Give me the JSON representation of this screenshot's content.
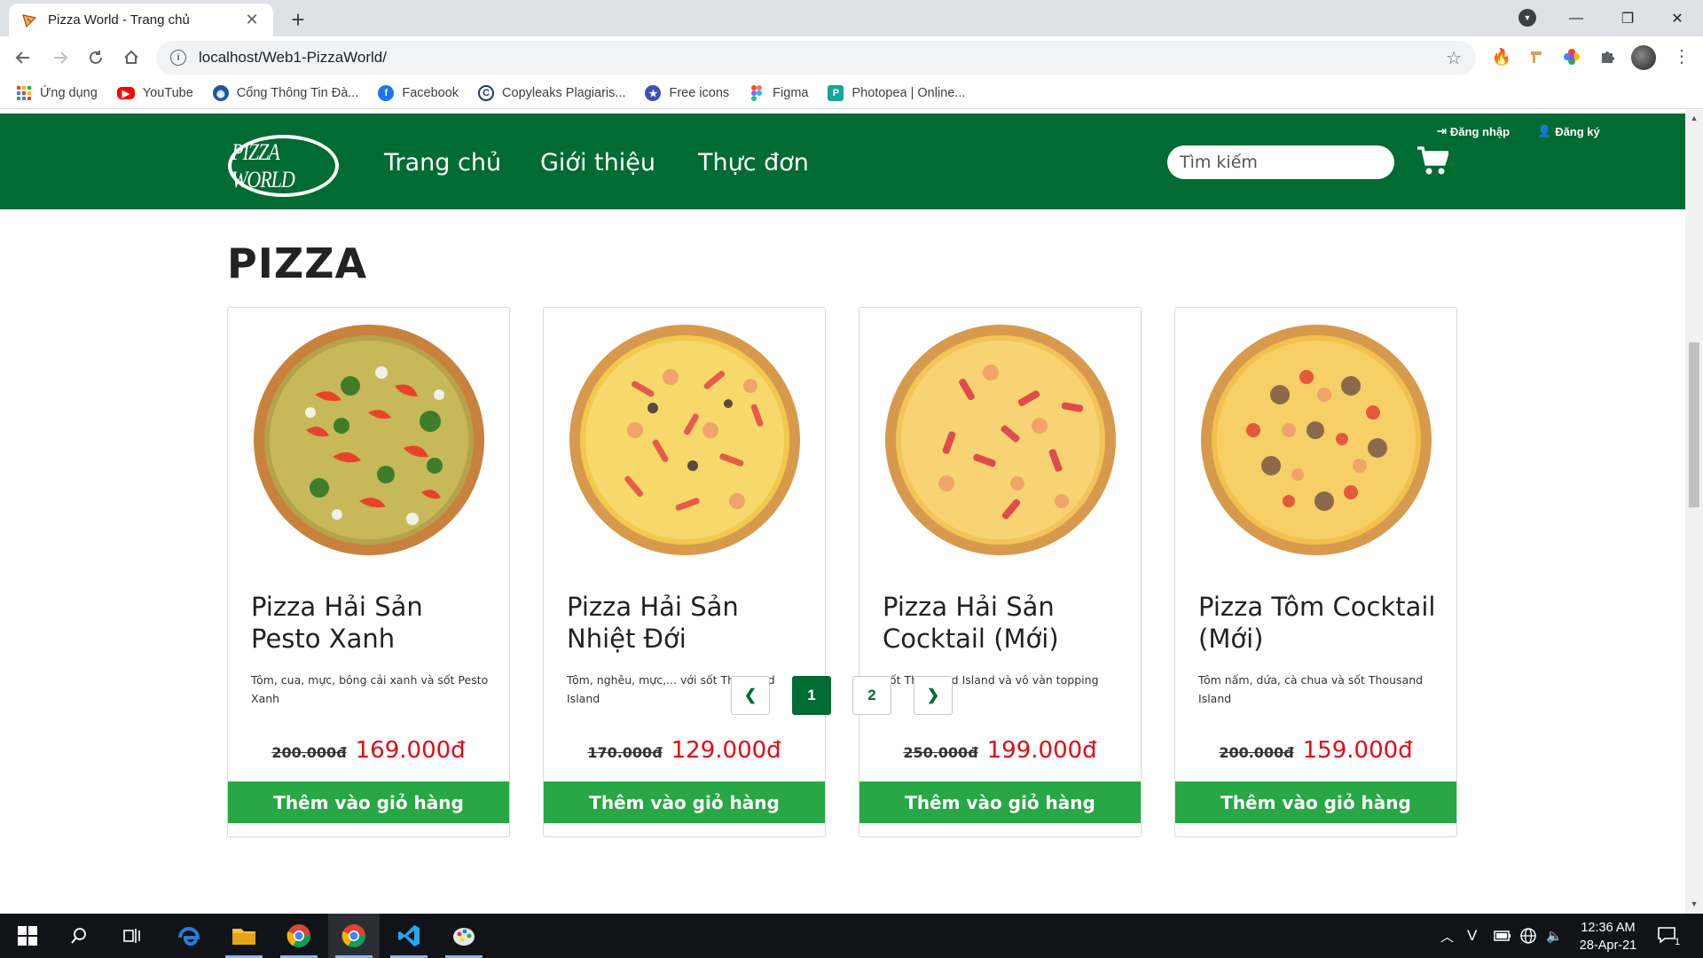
{
  "browser": {
    "tab_title": "Pizza World - Trang chủ",
    "url": "localhost/Web1-PizzaWorld/",
    "bookmarks": [
      {
        "label": "Ứng dụng",
        "icon": "apps-grid-icon",
        "color": "#ea4335"
      },
      {
        "label": "YouTube",
        "icon": "youtube-icon",
        "color": "#ff0000"
      },
      {
        "label": "Cổng Thông Tin Đà...",
        "icon": "portal-icon",
        "color": "#1a56a8"
      },
      {
        "label": "Facebook",
        "icon": "facebook-icon",
        "color": "#1877f2"
      },
      {
        "label": "Copyleaks Plagiaris...",
        "icon": "copyleaks-icon",
        "color": "#1e3a5f"
      },
      {
        "label": "Free icons",
        "icon": "free-icons-icon",
        "color": "#3f51b5"
      },
      {
        "label": "Figma",
        "icon": "figma-icon",
        "color": "#f24e1e"
      },
      {
        "label": "Photopea | Online...",
        "icon": "photopea-icon",
        "color": "#18a497"
      }
    ]
  },
  "header": {
    "logo_text": "PIZZA WORLD",
    "nav": [
      "Trang chủ",
      "Giới thiệu",
      "Thực đơn"
    ],
    "search_placeholder": "Tìm kiếm",
    "login": "Đăng nhập",
    "register": "Đăng ký",
    "brand_color": "#006b32"
  },
  "section_title": "PIZZA",
  "products": [
    {
      "name": "Pizza Hải Sản Pesto Xanh",
      "desc": "Tôm, cua, mực, bông cải xanh và sốt Pesto Xanh",
      "old_price": "200.000đ",
      "new_price": "169.000đ",
      "button": "Thêm vào giỏ hàng"
    },
    {
      "name": "Pizza Hải Sản Nhiệt Đới",
      "desc": "Tôm, nghêu, mực,... với sốt Thousand Island",
      "old_price": "170.000đ",
      "new_price": "129.000đ",
      "button": "Thêm vào giỏ hàng"
    },
    {
      "name": "Pizza Hải Sản Cocktail (Mới)",
      "desc": "Sốt Thousand Island và vô vàn topping",
      "old_price": "250.000đ",
      "new_price": "199.000đ",
      "button": "Thêm vào giỏ hàng"
    },
    {
      "name": "Pizza Tôm Cocktail (Mới)",
      "desc": "Tôm nấm, dứa, cà chua và sốt Thousand Island",
      "old_price": "200.000đ",
      "new_price": "159.000đ",
      "button": "Thêm vào giỏ hàng"
    }
  ],
  "pagination": {
    "pages": [
      "1",
      "2"
    ],
    "current": "1"
  },
  "taskbar": {
    "time": "12:36 AM",
    "date": "28-Apr-21",
    "notification_count": "1"
  }
}
